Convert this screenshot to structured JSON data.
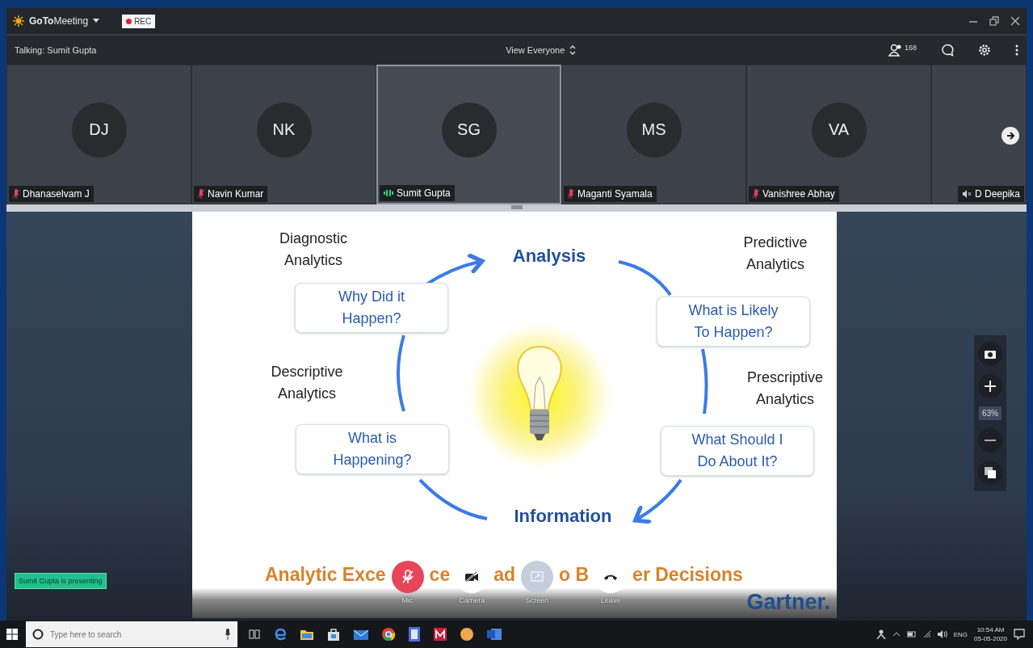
{
  "window": {
    "app_name": "**GoTo**Meeting",
    "rec_badge": "REC",
    "talking": "Talking: Sumit Gupta",
    "view_selector": "View Everyone",
    "participant_count": "168"
  },
  "participants": [
    {
      "initials": "DJ",
      "name": "Dhanaselvam J",
      "kind": "muted",
      "selected": false
    },
    {
      "initials": "NK",
      "name": "Navin Kumar",
      "kind": "muted",
      "selected": false
    },
    {
      "initials": "SG",
      "name": "Sumit Gupta",
      "kind": "speaking",
      "selected": true
    },
    {
      "initials": "MS",
      "name": "Maganti Syamala",
      "kind": "muted",
      "selected": false
    },
    {
      "initials": "VA",
      "name": "Vanishree Abhay",
      "kind": "muted",
      "selected": false
    },
    {
      "name": "D Deepika",
      "kind": "speakeroff",
      "selected": false
    }
  ],
  "slide": {
    "stages": [
      {
        "label": "Diagnostic\nAnalytics",
        "question": "Why Did it\nHappen?"
      },
      {
        "label": "Predictive\nAnalytics",
        "question": "What is Likely\nTo Happen?"
      },
      {
        "label": "Descriptive\nAnalytics",
        "question": "What is\nHappening?"
      },
      {
        "label": "Prescriptive\nAnalytics",
        "question": "What Should I\nDo About It?"
      }
    ],
    "nodes": [
      "Analysis",
      "Information"
    ],
    "title_fragments": [
      "Analytic Exce",
      "ce",
      "ad",
      "o B",
      "er Decisions"
    ],
    "brand": "Gartner."
  },
  "presenter_badge": "Sumit Gupta is presenting",
  "controls": [
    {
      "kind": "mic",
      "label": "Mic",
      "highlighted": true,
      "disabled": false
    },
    {
      "kind": "camera",
      "label": "Camera",
      "highlighted": false,
      "disabled": false
    },
    {
      "kind": "screen",
      "label": "Screen",
      "highlighted": false,
      "disabled": true
    },
    {
      "kind": "leave",
      "label": "Leave",
      "highlighted": false,
      "disabled": false
    }
  ],
  "zoom": {
    "reading": "63%"
  },
  "taskbar": {
    "search": {
      "placeholder": "Type here to search"
    },
    "language": "ENG",
    "time": "10:54 AM",
    "date": "05-05-2020"
  }
}
